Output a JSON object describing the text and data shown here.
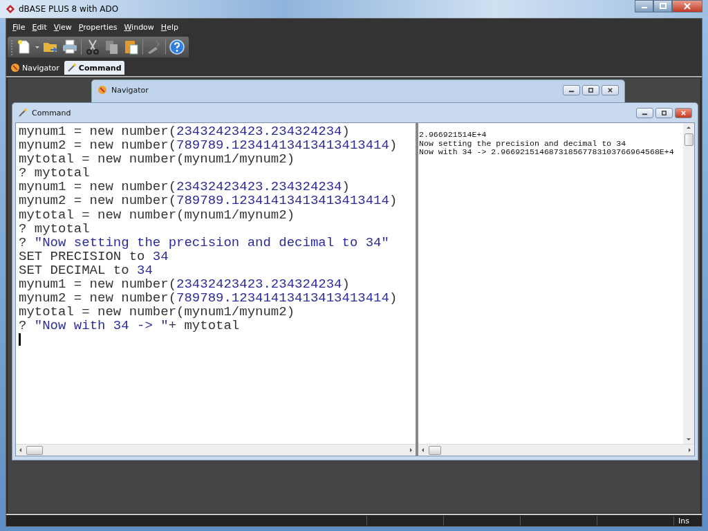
{
  "window": {
    "title": "dBASE PLUS 8 with ADO"
  },
  "menu": [
    {
      "label": "File"
    },
    {
      "label": "Edit"
    },
    {
      "label": "View"
    },
    {
      "label": "Properties"
    },
    {
      "label": "Window"
    },
    {
      "label": "Help"
    }
  ],
  "tabs": [
    {
      "label": "Navigator",
      "kind": "navigator",
      "selected": false
    },
    {
      "label": "Command",
      "kind": "command",
      "selected": true
    }
  ],
  "navigator_window": {
    "title": "Navigator"
  },
  "command_window": {
    "title": "Command",
    "code_lines": [
      [
        {
          "kind": "plain",
          "text": "mynum1 = new number("
        },
        {
          "kind": "literal",
          "text": "23432423423.234324234"
        },
        {
          "kind": "plain",
          "text": ")"
        }
      ],
      [
        {
          "kind": "plain",
          "text": "mynum2 = new number("
        },
        {
          "kind": "literal",
          "text": "789789.12341413413413413414"
        },
        {
          "kind": "plain",
          "text": ")"
        }
      ],
      [
        {
          "kind": "plain",
          "text": "mytotal = new number(mynum1/mynum2)"
        }
      ],
      [
        {
          "kind": "plain",
          "text": "? mytotal"
        }
      ],
      [
        {
          "kind": "plain",
          "text": "mynum1 = new number("
        },
        {
          "kind": "literal",
          "text": "23432423423.234324234"
        },
        {
          "kind": "plain",
          "text": ")"
        }
      ],
      [
        {
          "kind": "plain",
          "text": "mynum2 = new number("
        },
        {
          "kind": "literal",
          "text": "789789.12341413413413413414"
        },
        {
          "kind": "plain",
          "text": ")"
        }
      ],
      [
        {
          "kind": "plain",
          "text": "mytotal = new number(mynum1/mynum2)"
        }
      ],
      [
        {
          "kind": "plain",
          "text": "? mytotal"
        }
      ],
      [
        {
          "kind": "plain",
          "text": "? "
        },
        {
          "kind": "literal",
          "text": "\"Now setting the precision and decimal to 34\""
        }
      ],
      [
        {
          "kind": "plain",
          "text": "SET PRECISION to "
        },
        {
          "kind": "literal",
          "text": "34"
        }
      ],
      [
        {
          "kind": "plain",
          "text": "SET DECIMAL to "
        },
        {
          "kind": "literal",
          "text": "34"
        }
      ],
      [
        {
          "kind": "plain",
          "text": "mynum1 = new number("
        },
        {
          "kind": "literal",
          "text": "23432423423.234324234"
        },
        {
          "kind": "plain",
          "text": ")"
        }
      ],
      [
        {
          "kind": "plain",
          "text": "mynum2 = new number("
        },
        {
          "kind": "literal",
          "text": "789789.12341413413413413414"
        },
        {
          "kind": "plain",
          "text": ")"
        }
      ],
      [
        {
          "kind": "plain",
          "text": "mytotal = new number(mynum1/mynum2)"
        }
      ],
      [
        {
          "kind": "plain",
          "text": "? "
        },
        {
          "kind": "literal",
          "text": "\"Now with 34 -> \""
        },
        {
          "kind": "plain",
          "text": "+ mytotal"
        }
      ]
    ],
    "output_lines": [
      "2.966921514E+4",
      "Now setting the precision and decimal to 34",
      "Now with 34 -> 2.966921514687318567783103766964568E+4"
    ]
  },
  "status_bar": {
    "mode": "Ins"
  }
}
